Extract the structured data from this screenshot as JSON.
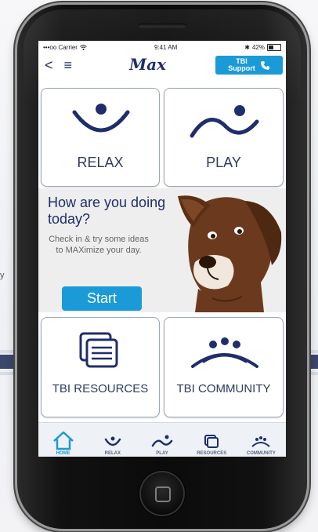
{
  "status_bar": {
    "carrier": "•••oo Carrier",
    "time": "9:41 AM",
    "battery": "42%"
  },
  "header": {
    "back": "<",
    "menu": "≡",
    "logo": "Max",
    "support_line1": "TBI",
    "support_line2": "Support"
  },
  "tiles": {
    "relax": "RELAX",
    "play": "PLAY",
    "resources": "TBI RESOURCES",
    "community": "TBI COMMUNITY"
  },
  "checkin": {
    "question": "How are you doing today?",
    "subtext": "Check in & try some ideas to MAXimize your day.",
    "start": "Start"
  },
  "tabs": [
    {
      "label": "HOME",
      "icon": "home-icon",
      "active": true
    },
    {
      "label": "RELAX",
      "icon": "relax-icon",
      "active": false
    },
    {
      "label": "PLAY",
      "icon": "play-icon",
      "active": false
    },
    {
      "label": "RESOURCES",
      "icon": "resources-icon",
      "active": false
    },
    {
      "label": "COMMUNITY",
      "icon": "community-icon",
      "active": false
    }
  ],
  "colors": {
    "accent": "#1a9ad6",
    "navy": "#1f2e6b",
    "dog": "#6b3a1e"
  }
}
